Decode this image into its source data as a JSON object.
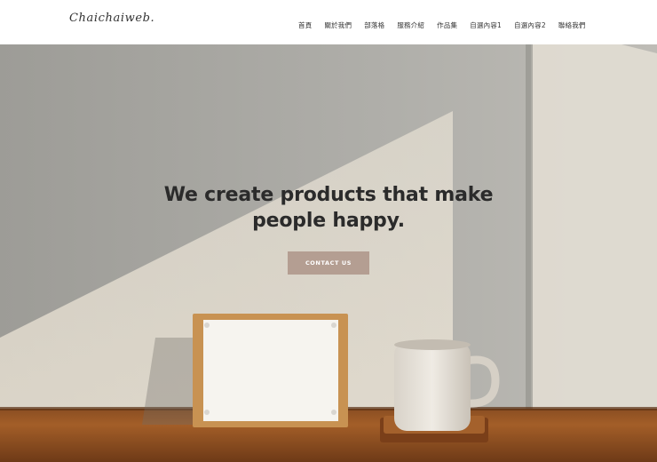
{
  "brand": {
    "logo": "Chaichaiweb."
  },
  "nav": {
    "items": [
      {
        "label": "首頁"
      },
      {
        "label": "關於我們"
      },
      {
        "label": "部落格"
      },
      {
        "label": "服務介紹"
      },
      {
        "label": "作品集"
      },
      {
        "label": "自選內容1"
      },
      {
        "label": "自選內容2"
      },
      {
        "label": "聯絡我們"
      }
    ]
  },
  "hero": {
    "title_line1": "We create products that make",
    "title_line2": "people happy.",
    "cta_label": "CONTACT US"
  },
  "colors": {
    "cta_bg": "#b49e92",
    "title": "#2b2b2b",
    "nav_text": "#333333"
  }
}
